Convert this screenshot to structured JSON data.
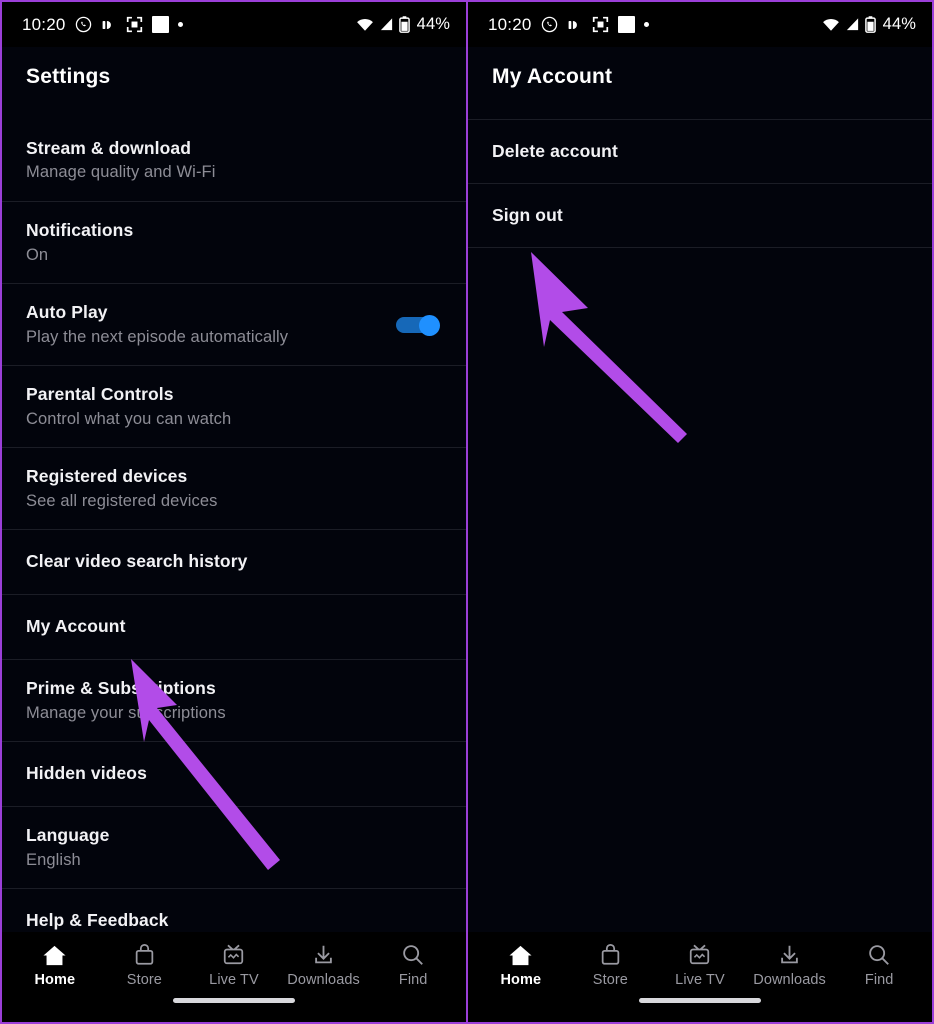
{
  "accent": {
    "arrow": "#b24ce8",
    "panel_border": "#9b3fd8",
    "toggle_on_track": "#1668b8",
    "toggle_on_thumb": "#1f90ff",
    "divider": "#1b1d26",
    "bg": "#02040c",
    "statusbar_bg": "#000000",
    "subtitle_text": "#8d8d96"
  },
  "status_bar": {
    "time": "10:20",
    "battery_percent": "44%",
    "left_icons": [
      "whatsapp-icon",
      "half-circle-icon",
      "screenshot-frame-icon",
      "white-square-icon",
      "dot-icon"
    ],
    "right_icons": [
      "wifi-icon",
      "cellular-signal-icon",
      "battery-icon"
    ]
  },
  "left_panel": {
    "header_title": "Settings",
    "rows": [
      {
        "title": "Stream & download",
        "subtitle": "Manage quality and Wi-Fi",
        "toggle": null
      },
      {
        "title": "Notifications",
        "subtitle": "On",
        "toggle": null
      },
      {
        "title": "Auto Play",
        "subtitle": "Play the next episode automatically",
        "toggle": "on"
      },
      {
        "title": "Parental Controls",
        "subtitle": "Control what you can watch",
        "toggle": null
      },
      {
        "title": "Registered devices",
        "subtitle": "See all registered devices",
        "toggle": null
      },
      {
        "title": "Clear video search history",
        "subtitle": "",
        "toggle": null
      },
      {
        "title": "My Account",
        "subtitle": "",
        "toggle": null
      },
      {
        "title": "Prime & Subscriptions",
        "subtitle": "Manage your subscriptions",
        "toggle": null
      },
      {
        "title": "Hidden videos",
        "subtitle": "",
        "toggle": null
      },
      {
        "title": "Language",
        "subtitle": "English",
        "toggle": null
      },
      {
        "title": "Help & Feedback",
        "subtitle": "",
        "toggle": null
      }
    ],
    "annotation_arrow_target": "My Account"
  },
  "right_panel": {
    "header_title": "My Account",
    "rows": [
      {
        "title": "Delete account",
        "subtitle": "",
        "toggle": null
      },
      {
        "title": "Sign out",
        "subtitle": "",
        "toggle": null
      }
    ],
    "annotation_arrow_target": "Sign out"
  },
  "bottom_nav": {
    "items": [
      {
        "label": "Home",
        "icon": "home-icon",
        "active": true
      },
      {
        "label": "Store",
        "icon": "shopping-bag-icon",
        "active": false
      },
      {
        "label": "Live TV",
        "icon": "live-tv-icon",
        "active": false
      },
      {
        "label": "Downloads",
        "icon": "download-icon",
        "active": false
      },
      {
        "label": "Find",
        "icon": "search-icon",
        "active": false
      }
    ]
  }
}
